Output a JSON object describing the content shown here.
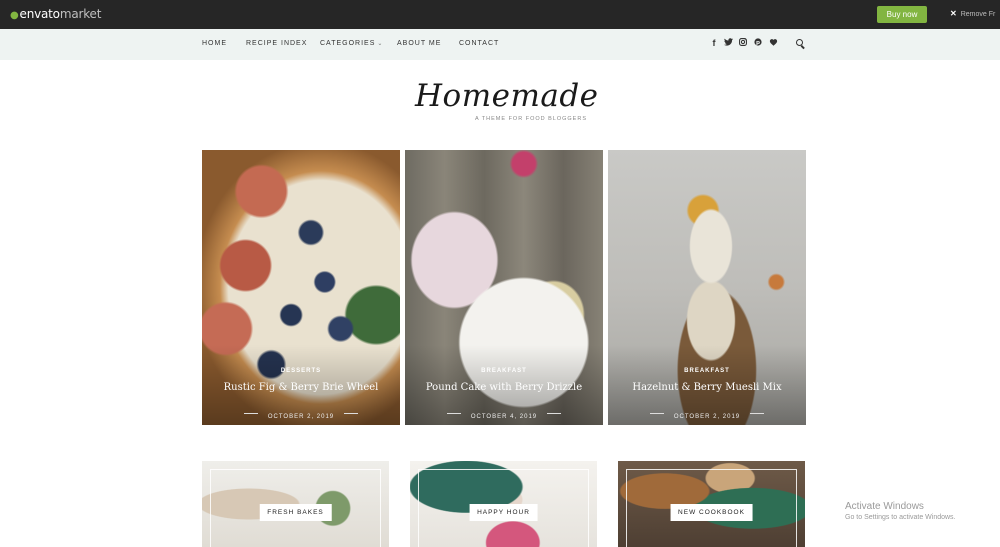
{
  "envato_bar": {
    "logo_main": "envato",
    "logo_sub": "market",
    "buy_label": "Buy now",
    "remove_label": "Remove Fr"
  },
  "nav": {
    "items": [
      {
        "label": "HOME"
      },
      {
        "label": "RECIPE INDEX"
      },
      {
        "label": "CATEGORIES"
      },
      {
        "label": "ABOUT ME"
      },
      {
        "label": "CONTACT"
      }
    ],
    "social": [
      "facebook-icon",
      "twitter-icon",
      "instagram-icon",
      "pinterest-icon",
      "heart-icon"
    ]
  },
  "logo": {
    "name": "Homemade",
    "tagline": "A THEME FOR FOOD BLOGGERS"
  },
  "featured": [
    {
      "category": "DESSERTS",
      "title": "Rustic Fig & Berry Brie Wheel",
      "date": "OCTOBER 2, 2019"
    },
    {
      "category": "BREAKFAST",
      "title": "Pound Cake with Berry Drizzle",
      "date": "OCTOBER 4, 2019"
    },
    {
      "category": "BREAKFAST",
      "title": "Hazelnut & Berry Muesli Mix",
      "date": "OCTOBER 2, 2019"
    }
  ],
  "promos": [
    {
      "label": "FRESH BAKES"
    },
    {
      "label": "HAPPY HOUR"
    },
    {
      "label": "NEW COOKBOOK"
    }
  ],
  "watermark": {
    "line1": "Activate Windows",
    "line2": "Go to Settings to activate Windows."
  },
  "colors": {
    "envato_green": "#82b541",
    "nav_bg": "#eef3f2",
    "topbar_bg": "#262626"
  }
}
